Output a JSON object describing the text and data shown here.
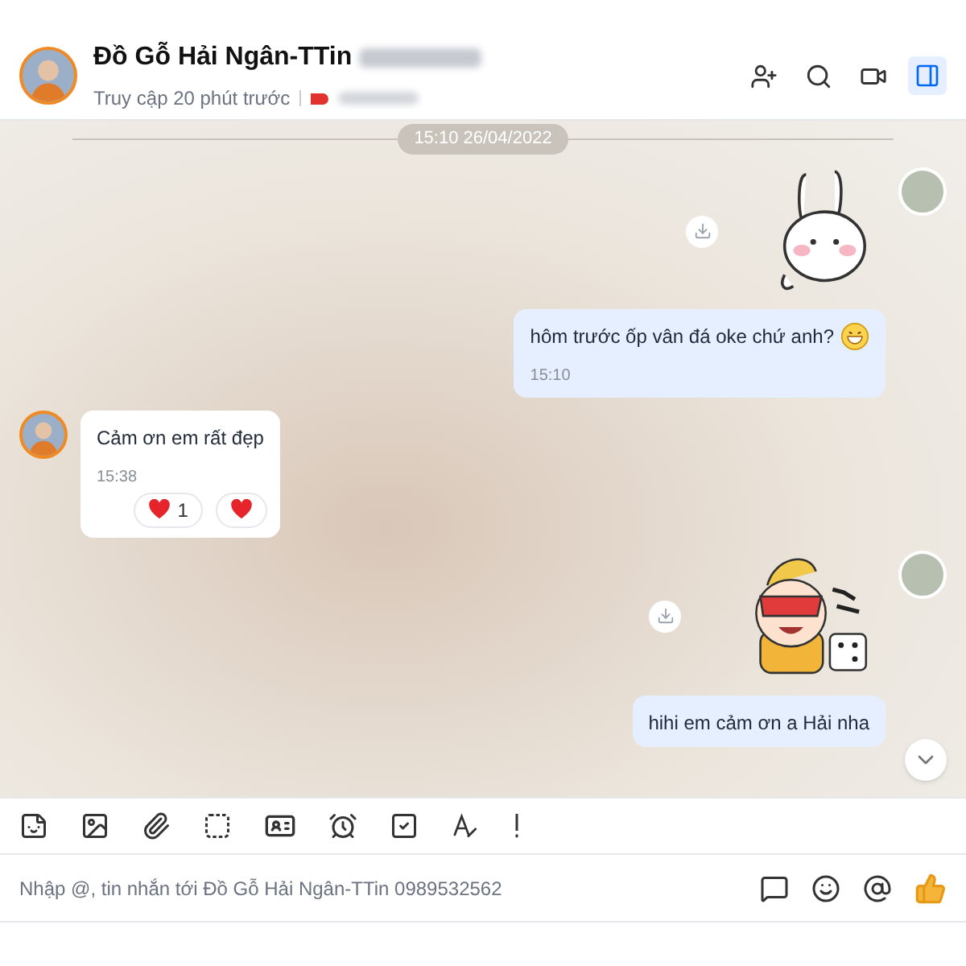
{
  "header": {
    "name": "Đồ Gỗ Hải Ngân-TTin",
    "status": "Truy cập 20 phút trước"
  },
  "date_separator": "15:10 26/04/2022",
  "messages": [
    {
      "kind": "bunny_sticker",
      "from_me": true,
      "avatar": true
    },
    {
      "kind": "text",
      "from_me": true,
      "text": "hôm trước ốp vân đá oke chứ anh?",
      "grin_emoji": true,
      "time": "15:10",
      "avatar": false
    },
    {
      "kind": "text",
      "from_me": false,
      "text": "Cảm ơn em rất đẹp",
      "time": "15:38",
      "avatar": true,
      "reactions": [
        {
          "kind": "heart",
          "count": "1"
        },
        {
          "kind": "heart"
        }
      ]
    },
    {
      "kind": "mask_sticker",
      "from_me": true,
      "avatar": true
    },
    {
      "kind": "text",
      "from_me": true,
      "text": "hihi em cảm ơn a Hải nha",
      "avatar": false
    }
  ],
  "input": {
    "placeholder": "Nhập @, tin nhắn tới Đồ Gỗ Hải Ngân-TTin 0989532562"
  }
}
